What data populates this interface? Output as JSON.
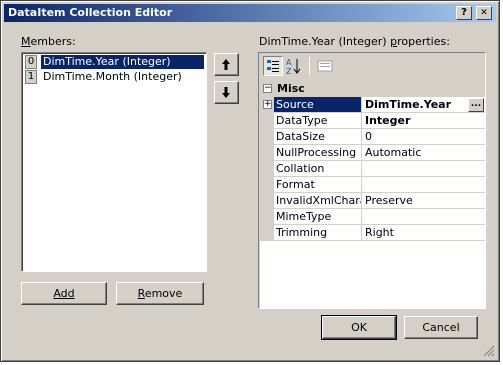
{
  "window": {
    "title": "DataItem Collection Editor",
    "help_button": "?",
    "close_button": "✕"
  },
  "members": {
    "label": "Members:",
    "items": [
      {
        "index": "0",
        "text": "DimTime.Year (Integer)",
        "selected": true
      },
      {
        "index": "1",
        "text": "DimTime.Month (Integer)",
        "selected": false
      }
    ],
    "move_up_icon": "up-arrow-icon",
    "move_down_icon": "down-arrow-icon"
  },
  "buttons": {
    "add": "Add",
    "remove": "Remove",
    "ok": "OK",
    "cancel": "Cancel"
  },
  "properties": {
    "label": "DimTime.Year (Integer) properties:",
    "toolbar": [
      "categorized-icon",
      "alphabetical-icon",
      "property-pages-icon"
    ],
    "category": "Misc",
    "rows": [
      {
        "name": "Source",
        "value": "DimTime.Year",
        "bold": true,
        "expandable": true,
        "selected": true
      },
      {
        "name": "DataType",
        "value": "Integer",
        "bold": true
      },
      {
        "name": "DataSize",
        "value": "0"
      },
      {
        "name": "NullProcessing",
        "value": "Automatic"
      },
      {
        "name": "Collation",
        "value": ""
      },
      {
        "name": "Format",
        "value": ""
      },
      {
        "name": "InvalidXmlCharact",
        "value": "Preserve"
      },
      {
        "name": "MimeType",
        "value": ""
      },
      {
        "name": "Trimming",
        "value": "Right"
      }
    ],
    "ellipsis": "..."
  },
  "colors": {
    "selection": "#0a246a",
    "face": "#d4d0c8"
  }
}
